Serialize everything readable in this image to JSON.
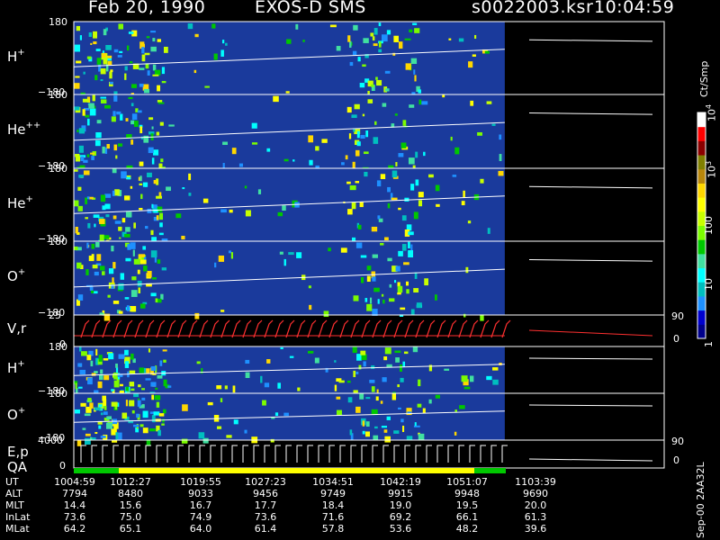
{
  "header": {
    "date": "Feb 20, 1990",
    "instrument": "EXOS-D SMS",
    "file": "s0022003.ksr",
    "time": "10:04:59"
  },
  "colorbar": {
    "unit": "Ct/Smp",
    "ticks": [
      {
        "label": "1",
        "value": 1
      },
      {
        "label": "10",
        "value": 10
      },
      {
        "label": "100",
        "value": 100
      },
      {
        "label": "10",
        "sup": "3",
        "value": 1000
      },
      {
        "label": "10",
        "sup": "4",
        "value": 10000
      }
    ],
    "colors": [
      "#00008b",
      "#0000cd",
      "#1e90ff",
      "#00bfbf",
      "#00ffff",
      "#40e0a0",
      "#00c800",
      "#7cfc00",
      "#c8ff00",
      "#ffff00",
      "#ffd700",
      "#b8860b",
      "#808000",
      "#8b0000",
      "#ff0000",
      "#ffffff"
    ]
  },
  "chart_data": {
    "type": "heatmap",
    "panels": [
      {
        "label": "H",
        "sup": "+",
        "ymax": "180",
        "ymin": "−180",
        "kind": "angle"
      },
      {
        "label": "He",
        "sup": "++",
        "ymax": "180",
        "ymin": "−180",
        "kind": "angle"
      },
      {
        "label": "He",
        "sup": "+",
        "ymax": "180",
        "ymin": "−180",
        "kind": "angle"
      },
      {
        "label": "O",
        "sup": "+",
        "ymax": "180",
        "ymin": "−180",
        "kind": "angle"
      },
      {
        "label": "V,r",
        "sup": "",
        "ymax": "25",
        "ymin": "0",
        "right_top": "90",
        "right_bottom": "0",
        "kind": "line"
      },
      {
        "label": "H",
        "sup": "+",
        "ymax": "180",
        "ymin": "−180",
        "kind": "angle"
      },
      {
        "label": "O",
        "sup": "+",
        "ymax": "180",
        "ymin": "−180",
        "kind": "angle"
      },
      {
        "label": "E,p",
        "sup": "",
        "ymax": "4000",
        "ymin": "0",
        "right_top": "90",
        "right_bottom": "0",
        "kind": "line"
      }
    ],
    "qa_label": "QA",
    "data_end_fraction": 0.73,
    "rows": [
      {
        "name": "UT",
        "values": [
          "1004:59",
          "1012:27",
          "1019:55",
          "1027:23",
          "1034:51",
          "1042:19",
          "1051:07",
          "1103:39"
        ]
      },
      {
        "name": "ALT",
        "values": [
          "7794",
          "8480",
          "9033",
          "9456",
          "9749",
          "9915",
          "9948",
          "9690"
        ]
      },
      {
        "name": "MLT",
        "values": [
          "14.4",
          "15.6",
          "16.7",
          "17.7",
          "18.4",
          "19.0",
          "19.5",
          "20.0"
        ]
      },
      {
        "name": "InLat",
        "values": [
          "73.6",
          "75.0",
          "74.9",
          "73.6",
          "71.6",
          "69.2",
          "66.1",
          "61.3"
        ]
      },
      {
        "name": "MLat",
        "values": [
          "64.2",
          "65.1",
          "64.0",
          "61.4",
          "57.8",
          "53.6",
          "48.2",
          "39.6"
        ]
      }
    ]
  },
  "footer": {
    "code": "Sep-00  2AA32L"
  }
}
